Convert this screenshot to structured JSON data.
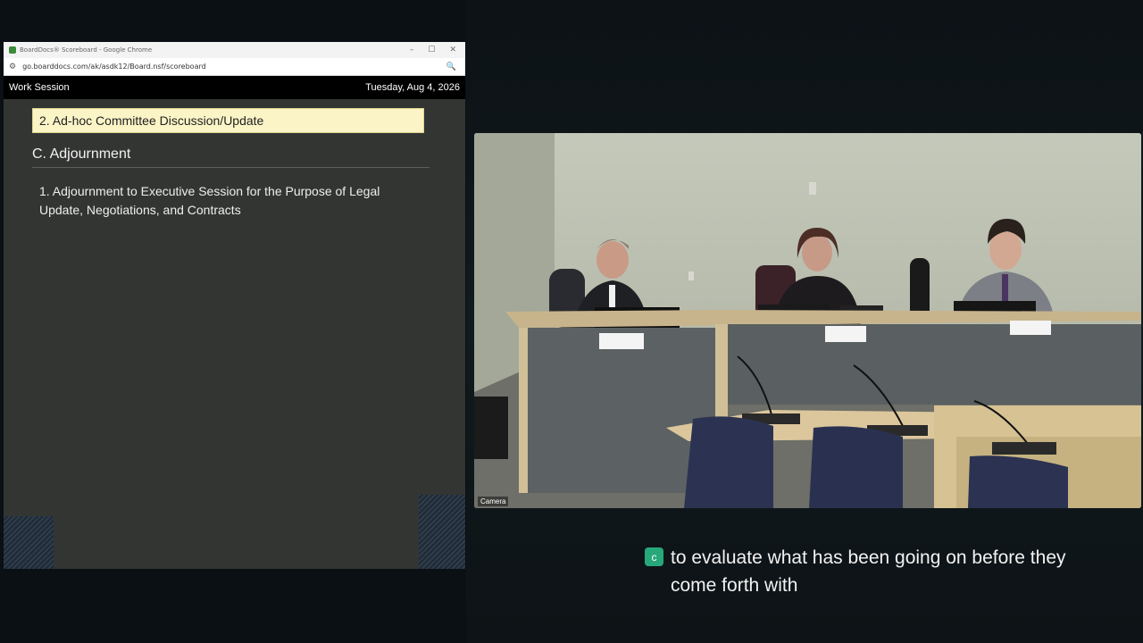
{
  "browser": {
    "window_title": "BoardDocs® Scoreboard - Google Chrome",
    "url": "go.boarddocs.com/ak/asdk12/Board.nsf/scoreboard",
    "controls": {
      "minimize": "–",
      "maximize": "☐",
      "close": "✕"
    }
  },
  "boarddocs": {
    "meeting_type": "Work Session",
    "date": "Tuesday, Aug 4, 2026",
    "current_item": "2. Ad-hoc Committee Discussion/Update",
    "section": "C. Adjournment",
    "items": [
      "1. Adjournment to Executive Session for the Purpose of Legal Update, Negotiations, and Contracts"
    ]
  },
  "camera": {
    "label": "Camera"
  },
  "caption": {
    "badge": "c",
    "text": "to evaluate what has been going on before they come forth with"
  },
  "colors": {
    "highlight": "#fbf4c6",
    "caption_badge": "#27a87a",
    "panel": "#333533"
  }
}
